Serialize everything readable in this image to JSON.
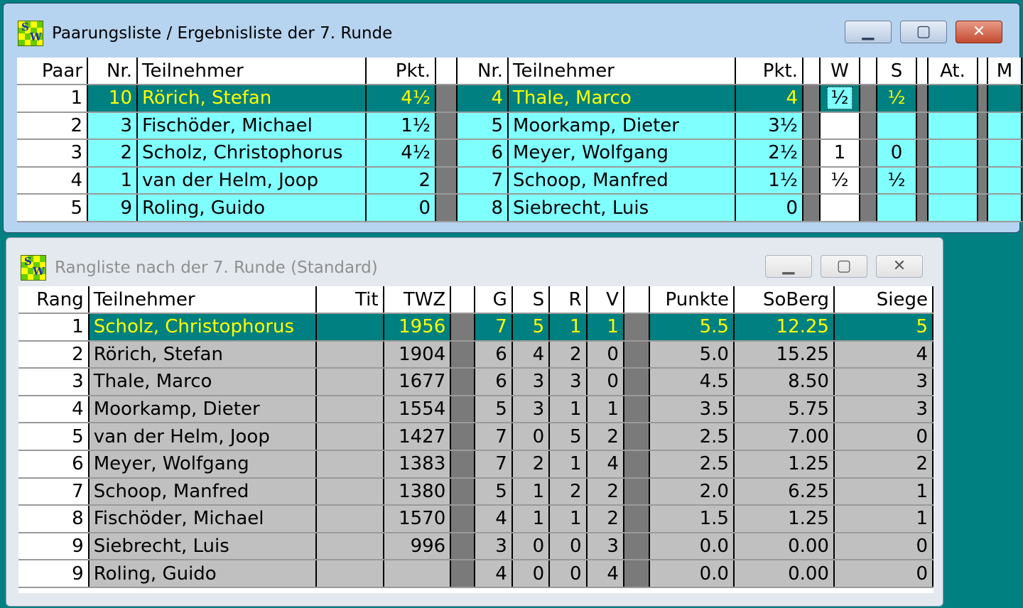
{
  "win1": {
    "title": "Paarungsliste / Ergebnisliste der 7. Runde",
    "minimize": "▁",
    "maximize": "▢",
    "close": "✕",
    "headers": {
      "paar": "Paar",
      "nr": "Nr.",
      "teilnehmer": "Teilnehmer",
      "pkt": "Pkt.",
      "nr2": "Nr.",
      "teilnehmer2": "Teilnehmer",
      "pkt2": "Pkt.",
      "w": "W",
      "s": "S",
      "at": "At.",
      "m": "M"
    },
    "rows": [
      {
        "paar": "1",
        "nr": "10",
        "name": "Rörich, Stefan",
        "pkt": "4½",
        "nr2": "4",
        "name2": "Thale, Marco",
        "pkt2": "4",
        "w": "½",
        "s": "½",
        "at": "",
        "m": ""
      },
      {
        "paar": "2",
        "nr": "3",
        "name": "Fischöder, Michael",
        "pkt": "1½",
        "nr2": "5",
        "name2": "Moorkamp, Dieter",
        "pkt2": "3½",
        "w": "",
        "s": "",
        "at": "",
        "m": ""
      },
      {
        "paar": "3",
        "nr": "2",
        "name": "Scholz, Christophorus",
        "pkt": "4½",
        "nr2": "6",
        "name2": "Meyer, Wolfgang",
        "pkt2": "2½",
        "w": "1",
        "s": "0",
        "at": "",
        "m": ""
      },
      {
        "paar": "4",
        "nr": "1",
        "name": "van der Helm, Joop",
        "pkt": "2",
        "nr2": "7",
        "name2": "Schoop, Manfred",
        "pkt2": "1½",
        "w": "½",
        "s": "½",
        "at": "",
        "m": ""
      },
      {
        "paar": "5",
        "nr": "9",
        "name": "Roling, Guido",
        "pkt": "0",
        "nr2": "8",
        "name2": "Siebrecht, Luis",
        "pkt2": "0",
        "w": "",
        "s": "",
        "at": "",
        "m": ""
      }
    ]
  },
  "win2": {
    "title": "Rangliste nach der 7. Runde (Standard)",
    "minimize": "▁",
    "maximize": "▢",
    "close": "✕",
    "headers": {
      "rang": "Rang",
      "teilnehmer": "Teilnehmer",
      "tit": "Tit",
      "twz": "TWZ",
      "g": "G",
      "s": "S",
      "r": "R",
      "v": "V",
      "punkte": "Punkte",
      "soberg": "SoBerg",
      "siege": "Siege"
    },
    "rows": [
      {
        "rang": "1",
        "name": "Scholz, Christophorus",
        "tit": "",
        "twz": "1956",
        "g": "7",
        "s": "5",
        "r": "1",
        "v": "1",
        "punkte": "5.5",
        "soberg": "12.25",
        "siege": "5"
      },
      {
        "rang": "2",
        "name": "Rörich, Stefan",
        "tit": "",
        "twz": "1904",
        "g": "6",
        "s": "4",
        "r": "2",
        "v": "0",
        "punkte": "5.0",
        "soberg": "15.25",
        "siege": "4"
      },
      {
        "rang": "3",
        "name": "Thale, Marco",
        "tit": "",
        "twz": "1677",
        "g": "6",
        "s": "3",
        "r": "3",
        "v": "0",
        "punkte": "4.5",
        "soberg": "8.50",
        "siege": "3"
      },
      {
        "rang": "4",
        "name": "Moorkamp, Dieter",
        "tit": "",
        "twz": "1554",
        "g": "5",
        "s": "3",
        "r": "1",
        "v": "1",
        "punkte": "3.5",
        "soberg": "5.75",
        "siege": "3"
      },
      {
        "rang": "5",
        "name": "van der Helm, Joop",
        "tit": "",
        "twz": "1427",
        "g": "7",
        "s": "0",
        "r": "5",
        "v": "2",
        "punkte": "2.5",
        "soberg": "7.00",
        "siege": "0"
      },
      {
        "rang": "6",
        "name": "Meyer, Wolfgang",
        "tit": "",
        "twz": "1383",
        "g": "7",
        "s": "2",
        "r": "1",
        "v": "4",
        "punkte": "2.5",
        "soberg": "1.25",
        "siege": "2"
      },
      {
        "rang": "7",
        "name": "Schoop, Manfred",
        "tit": "",
        "twz": "1380",
        "g": "5",
        "s": "1",
        "r": "2",
        "v": "2",
        "punkte": "2.0",
        "soberg": "6.25",
        "siege": "1"
      },
      {
        "rang": "8",
        "name": "Fischöder, Michael",
        "tit": "",
        "twz": "1570",
        "g": "4",
        "s": "1",
        "r": "1",
        "v": "2",
        "punkte": "1.5",
        "soberg": "1.25",
        "siege": "1"
      },
      {
        "rang": "9",
        "name": "Siebrecht, Luis",
        "tit": "",
        "twz": "996",
        "g": "3",
        "s": "0",
        "r": "0",
        "v": "3",
        "punkte": "0.0",
        "soberg": "0.00",
        "siege": "0"
      },
      {
        "rang": "9",
        "name": "Roling, Guido",
        "tit": "",
        "twz": "",
        "g": "4",
        "s": "0",
        "r": "0",
        "v": "4",
        "punkte": "0.0",
        "soberg": "0.00",
        "siege": "0"
      }
    ]
  },
  "colors": {
    "desktop": "#008080",
    "row_cyan": "#80ffff",
    "row_selected": "#008080",
    "selected_text": "#ffff00",
    "row_gray": "#c0c0c0"
  }
}
